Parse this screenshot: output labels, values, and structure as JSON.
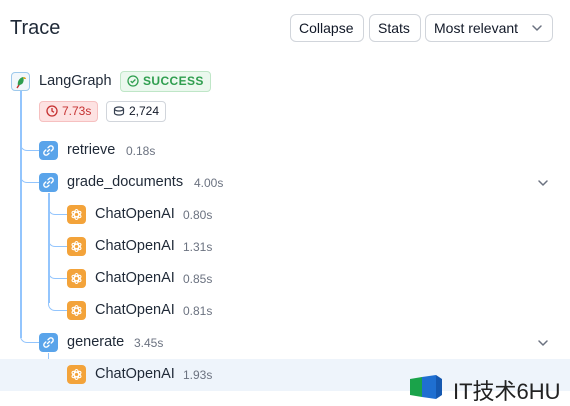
{
  "header": {
    "title": "Trace",
    "collapse_label": "Collapse",
    "stats_label": "Stats",
    "sort_label": "Most relevant"
  },
  "root": {
    "name": "LangGraph",
    "icon": "parrot-icon",
    "status": "SUCCESS",
    "latency": "7.73s",
    "tokens": "2,724"
  },
  "runs": [
    {
      "name": "retrieve",
      "duration": "0.18s",
      "type": "chain",
      "icon": "link-icon"
    },
    {
      "name": "grade_documents",
      "duration": "4.00s",
      "type": "chain",
      "icon": "link-icon",
      "expanded": true
    },
    {
      "name": "ChatOpenAI",
      "duration": "0.80s",
      "type": "llm",
      "icon": "openai-icon"
    },
    {
      "name": "ChatOpenAI",
      "duration": "1.31s",
      "type": "llm",
      "icon": "openai-icon"
    },
    {
      "name": "ChatOpenAI",
      "duration": "0.85s",
      "type": "llm",
      "icon": "openai-icon"
    },
    {
      "name": "ChatOpenAI",
      "duration": "0.81s",
      "type": "llm",
      "icon": "openai-icon"
    },
    {
      "name": "generate",
      "duration": "3.45s",
      "type": "chain",
      "icon": "link-icon",
      "expanded": true
    },
    {
      "name": "ChatOpenAI",
      "duration": "1.93s",
      "type": "llm",
      "icon": "openai-icon",
      "selected": true
    }
  ],
  "watermark": {
    "text": "IT技术6HU"
  },
  "colors": {
    "chain_icon": "#5aa4ea",
    "llm_icon": "#f3a33a",
    "tree_line": "#93c5fd",
    "success": "#2f9e4f",
    "latency": "#c53030",
    "selected_row": "#eef4fb"
  }
}
